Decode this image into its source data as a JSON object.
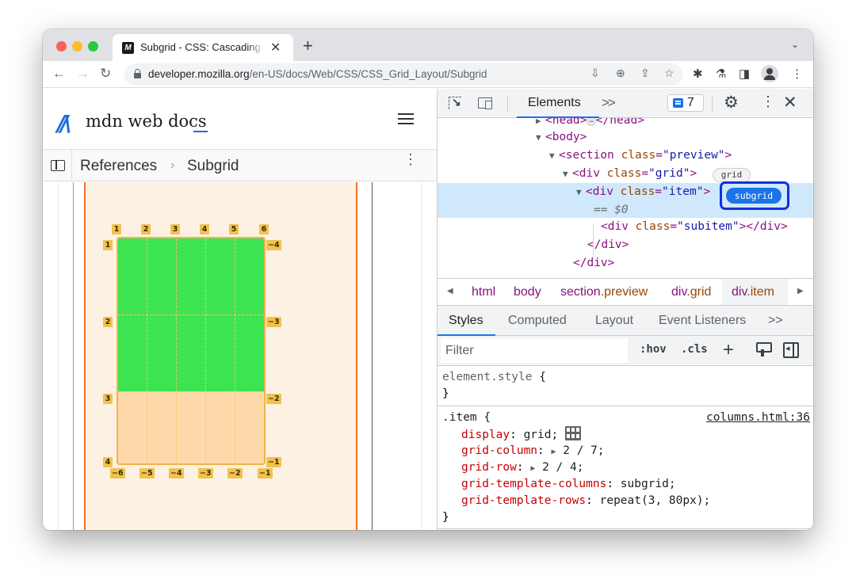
{
  "browser": {
    "tab": {
      "favicon": "M",
      "title": "Subgrid - CSS: Cascading Style Sheets | MDN"
    },
    "new_tab_label": "+",
    "tab_dropdown_icon": "chevron-down-icon",
    "url_host": "developer.mozilla.org",
    "url_path": "/en-US/docs/Web/CSS/CSS_Grid_Layout/Subgrid",
    "nav": {
      "back": "←",
      "forward": "→",
      "reload": "C"
    },
    "omnibox_icons": [
      "install-icon",
      "zoom-icon",
      "share-icon",
      "bookmark-star-icon"
    ],
    "toolbar_icons": [
      "extensions-icon",
      "labs-icon",
      "side-panel-icon",
      "profile-avatar",
      "menu-kebab-icon"
    ]
  },
  "mdn": {
    "logo_mark": "//\\",
    "logo_text": "mdn web docs",
    "breadcrumb": {
      "parent": "References",
      "separator": "›",
      "current": "Subgrid"
    }
  },
  "grid_overlay": {
    "column_top_labels": [
      "1",
      "2",
      "3",
      "4",
      "5",
      "6"
    ],
    "column_bottom_labels": [
      "-6",
      "-5",
      "-4",
      "-3",
      "-2",
      "-1"
    ],
    "row_left_labels": [
      "1",
      "2",
      "3",
      "4"
    ],
    "row_right_labels": [
      "-4",
      "-3",
      "-2",
      "-1"
    ],
    "colors": {
      "green": "#3ce452",
      "peach": "#fdd9a9",
      "badge": "#f1c24d",
      "border": "#f3b24a",
      "frame": "#f0732b"
    }
  },
  "devtools": {
    "tabs": {
      "elements": "Elements",
      "more": ">>"
    },
    "issues_count": "7",
    "dom": {
      "head_line": {
        "open": "<head>",
        "ellipsis": "…",
        "close": "</head>"
      },
      "body": "<body>",
      "section_tag": "<section ",
      "section_attr": "class",
      "section_val": "\"preview\"",
      "grid_tag": "<div ",
      "grid_attr": "class",
      "grid_val": "\"grid\"",
      "grid_badge": "grid",
      "item_tag": "<div ",
      "item_attr": "class",
      "item_val": "\"item\"",
      "item_badge": "subgrid",
      "selected_marker": "== $0",
      "subitem_tag_open": "<div ",
      "subitem_attr": "class",
      "subitem_val": "\"subitem\"",
      "subitem_close": "></div>",
      "close_div": "</div>",
      "close_div2": "</div>"
    },
    "crumbs": [
      {
        "tag": "html",
        "cls": ""
      },
      {
        "tag": "body",
        "cls": ""
      },
      {
        "tag": "section",
        "cls": ".preview"
      },
      {
        "tag": "div",
        "cls": ".grid"
      },
      {
        "tag": "div",
        "cls": ".item"
      }
    ],
    "panel_tabs": [
      "Styles",
      "Computed",
      "Layout",
      "Event Listeners",
      ">>"
    ],
    "filter": {
      "placeholder": "Filter",
      "hov": ":hov",
      "cls": ".cls"
    },
    "styles": {
      "element_style": {
        "selector": "element.style",
        "open": " {",
        "close": "}"
      },
      "item_rule": {
        "selector": ".item",
        "open": " {",
        "close": "}",
        "source": "columns.html:36",
        "declarations": [
          {
            "name": "display",
            "value": "grid;"
          },
          {
            "name": "grid-column",
            "value": "2 / 7;"
          },
          {
            "name": "grid-row",
            "value": "2 / 4;"
          },
          {
            "name": "grid-template-columns",
            "value": "subgrid;"
          },
          {
            "name": "grid-template-rows",
            "value": "repeat(3, 80px);"
          }
        ]
      }
    }
  }
}
